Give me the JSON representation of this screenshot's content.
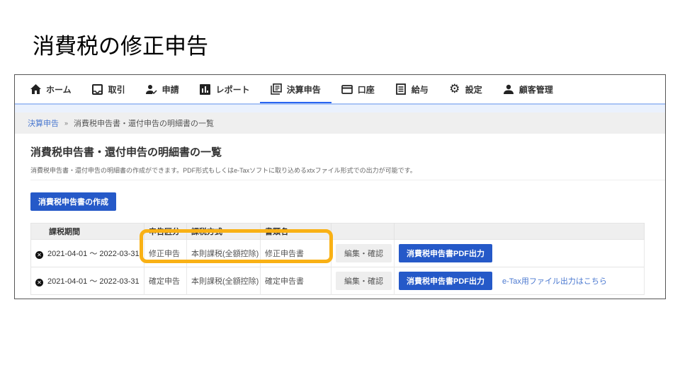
{
  "slide_title": "消費税の修正申告",
  "nav": {
    "items": [
      {
        "label": "ホーム",
        "icon": "home-icon"
      },
      {
        "label": "取引",
        "icon": "inbox-icon"
      },
      {
        "label": "申請",
        "icon": "user-check-icon"
      },
      {
        "label": "レポート",
        "icon": "bar-chart-icon"
      },
      {
        "label": "決算申告",
        "icon": "documents-icon",
        "active": true
      },
      {
        "label": "口座",
        "icon": "credit-card-icon"
      },
      {
        "label": "給与",
        "icon": "list-document-icon"
      },
      {
        "label": "設定",
        "icon": "gear-icon"
      },
      {
        "label": "顧客管理",
        "icon": "person-icon"
      }
    ]
  },
  "breadcrumb": {
    "parent": "決算申告",
    "separator": "»",
    "current": "消費税申告書・還付申告の明細書の一覧"
  },
  "page": {
    "title": "消費税申告書・還付申告の明細書の一覧",
    "description": "消費税申告書・還付申告の明細書の作成ができます。PDF形式もしくはe-Taxソフトに取り込めるxtxファイル形式での出力が可能です。",
    "create_button": "消費税申告書の作成"
  },
  "table": {
    "headers": [
      "課税期間",
      "申告区分",
      "課税方式",
      "書類名",
      "",
      ""
    ],
    "rows": [
      {
        "period": "2021-04-01 ～ 2022-03-31",
        "type": "修正申告",
        "method": "本則課税(全額控除)",
        "doc": "修正申告書",
        "edit": "編集・確認",
        "pdf": "消費税申告書PDF出力",
        "etax": ""
      },
      {
        "period": "2021-04-01 ～ 2022-03-31",
        "type": "確定申告",
        "method": "本則課税(全額控除)",
        "doc": "確定申告書",
        "edit": "編集・確認",
        "pdf": "消費税申告書PDF出力",
        "etax": "e-Tax用ファイル出力はこちら"
      }
    ]
  },
  "colors": {
    "accent": "#2559c8",
    "highlight": "#f9b115",
    "link": "#4a78d0"
  }
}
